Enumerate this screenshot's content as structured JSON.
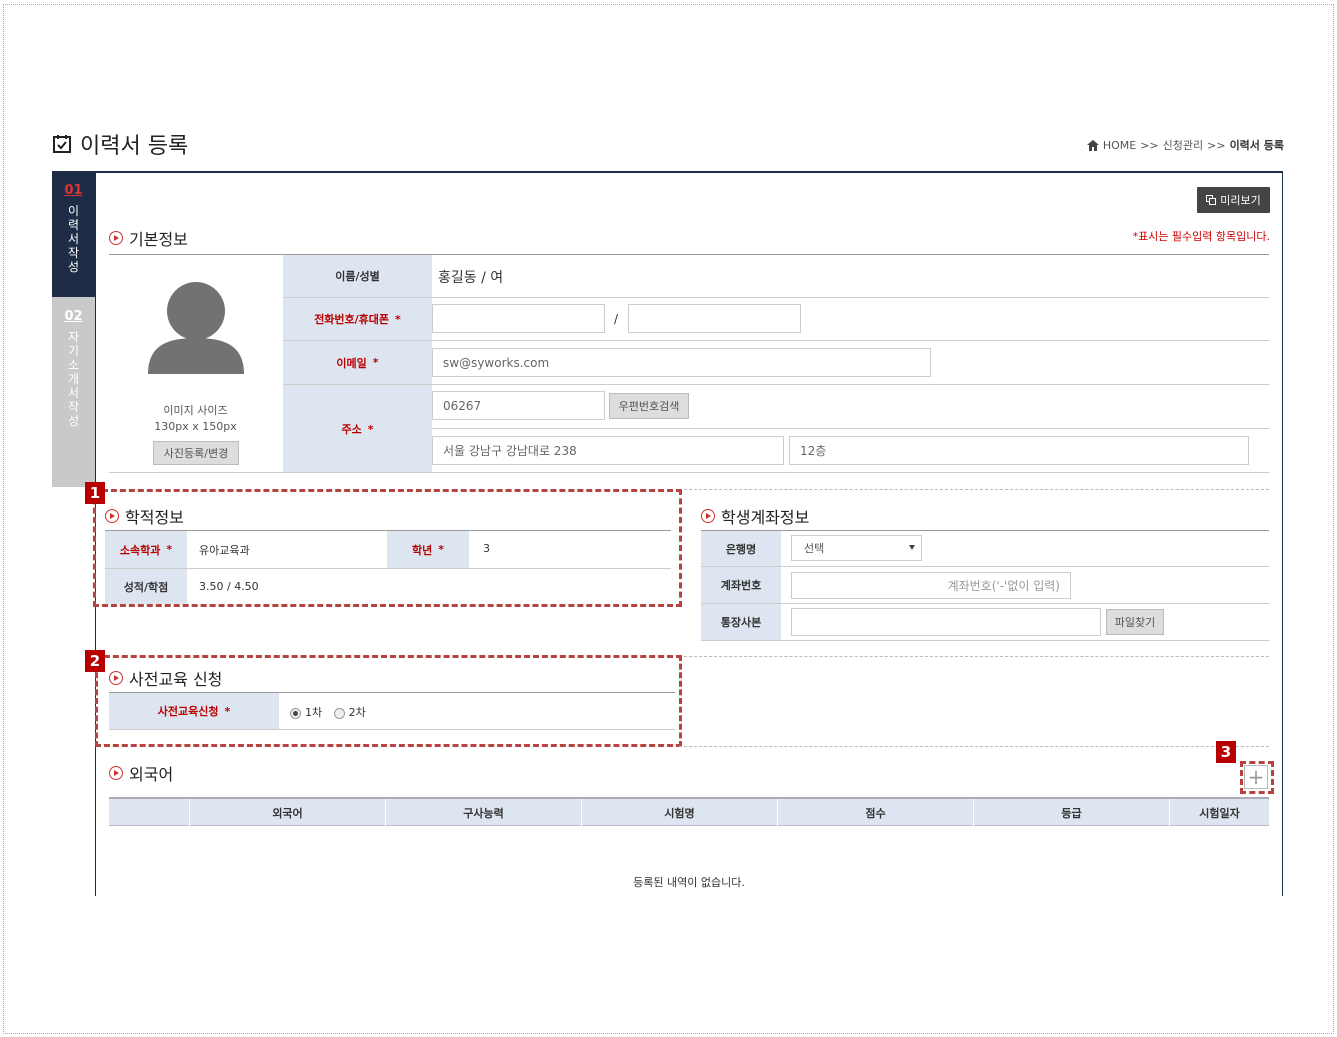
{
  "page": {
    "title": "이력서 등록",
    "breadcrumb": {
      "home": "HOME",
      "sep1": ">>",
      "mid": "신청관리",
      "sep2": ">>",
      "current": "이력서 등록"
    }
  },
  "steps": [
    {
      "num": "01",
      "label": "이력서작성"
    },
    {
      "num": "02",
      "label": "자기소개서작성"
    }
  ],
  "toolbar": {
    "preview_label": "미리보기"
  },
  "required_note": "*표시는 필수입력 항목입니다.",
  "basic": {
    "title": "기본정보",
    "image_size_label": "이미지 사이즈",
    "image_size_value": "130px x 150px",
    "photo_button": "사진등록/변경",
    "name_label": "이름/성별",
    "name_value": "홍길동 / 여",
    "phone_label": "전화번호/휴대폰",
    "phone_sep": "/",
    "email_label": "이메일",
    "email_value": "sw@syworks.com",
    "address_label": "주소",
    "zip_value": "06267",
    "zip_button": "우편번호검색",
    "addr1_value": "서울 강남구 강남대로 238",
    "addr2_value": "12층",
    "star": "*"
  },
  "academic": {
    "title": "학적정보",
    "dept_label": "소속학과",
    "dept_value": "유아교육과",
    "grade_label": "학년",
    "grade_value": "3",
    "gpa_label": "성적/학점",
    "gpa_value": "3.50 / 4.50"
  },
  "bank": {
    "title": "학생계좌정보",
    "bank_label": "은행명",
    "bank_select": "선택",
    "account_label": "계좌번호",
    "account_placeholder": "계좌번호('-'없이 입력)",
    "copy_label": "통장사본",
    "file_button": "파일찾기"
  },
  "pre_edu": {
    "title": "사전교육 신청",
    "label": "사전교육신청",
    "option1": "1차",
    "option2": "2차",
    "selected": "1차"
  },
  "foreign": {
    "title": "외국어",
    "add_icon": "plus-icon",
    "columns": [
      "외국어",
      "구사능력",
      "시험명",
      "점수",
      "등급",
      "시험일자"
    ],
    "empty_text": "등록된 내역이 없습니다."
  },
  "callouts": [
    "1",
    "2",
    "3"
  ],
  "colors": {
    "navy": "#1e2d45",
    "accent_red": "#b80000",
    "label_bg": "#dde6f0"
  }
}
